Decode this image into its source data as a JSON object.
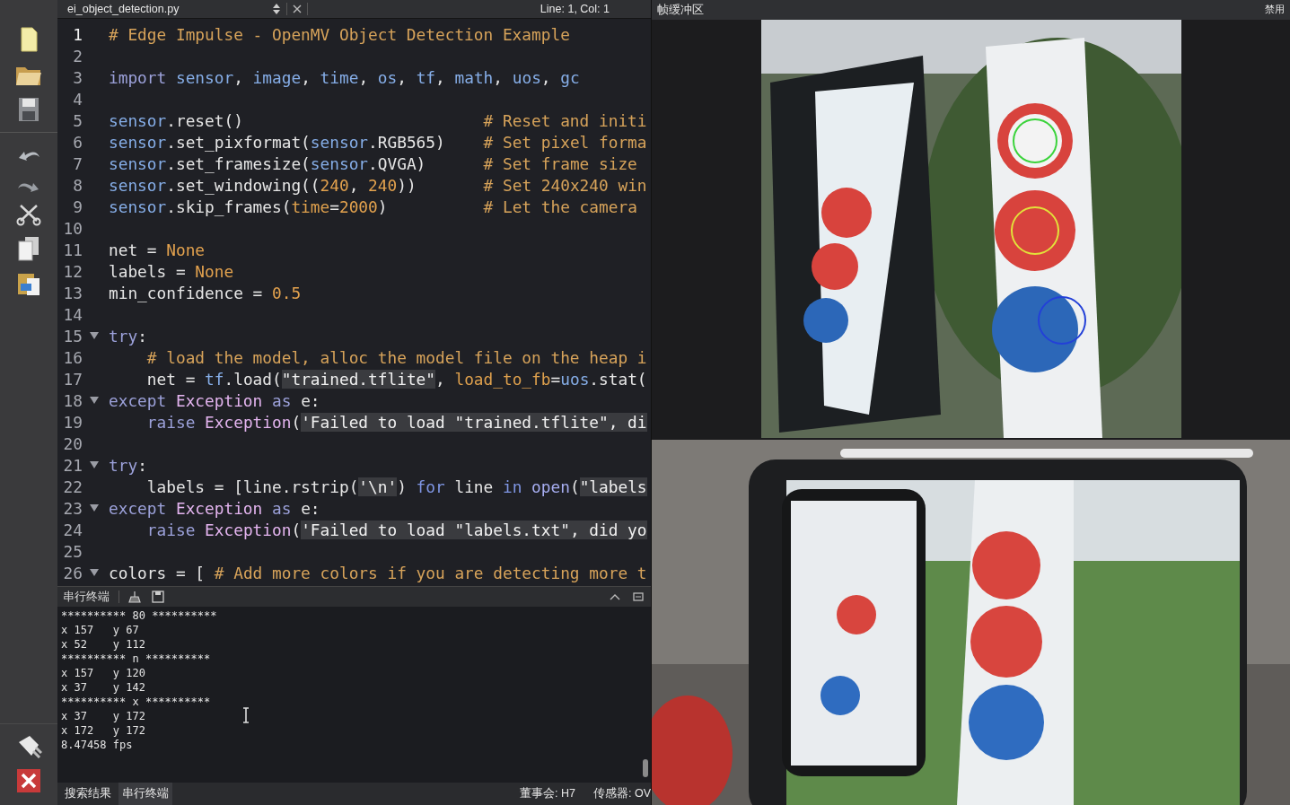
{
  "editor": {
    "file_name": "ei_object_detection.py",
    "cursor_position": "Line: 1, Col: 1",
    "lines": [
      {
        "number": "1",
        "current": true,
        "foldable": false,
        "tokens": [
          {
            "kind": "comment",
            "text": "# Edge Impulse - OpenMV Object Detection Example"
          }
        ]
      },
      {
        "number": "2",
        "current": false,
        "foldable": false
      },
      {
        "number": "3",
        "current": false,
        "foldable": false,
        "tokens": [
          {
            "kind": "keyword",
            "text": "import "
          },
          {
            "kind": "module",
            "text": "sensor"
          },
          {
            "kind": "plain",
            "text": ", "
          },
          {
            "kind": "module",
            "text": "image"
          },
          {
            "kind": "plain",
            "text": ", "
          },
          {
            "kind": "module",
            "text": "time"
          },
          {
            "kind": "plain",
            "text": ", "
          },
          {
            "kind": "module",
            "text": "os"
          },
          {
            "kind": "plain",
            "text": ", "
          },
          {
            "kind": "module",
            "text": "tf"
          },
          {
            "kind": "plain",
            "text": ", "
          },
          {
            "kind": "module",
            "text": "math"
          },
          {
            "kind": "plain",
            "text": ", "
          },
          {
            "kind": "module",
            "text": "uos"
          },
          {
            "kind": "plain",
            "text": ", "
          },
          {
            "kind": "module",
            "text": "gc"
          }
        ]
      },
      {
        "number": "4",
        "current": false,
        "foldable": false
      },
      {
        "number": "5",
        "current": false,
        "foldable": false,
        "tokens": [
          {
            "kind": "module",
            "text": "sensor"
          },
          {
            "kind": "plain",
            "text": ".reset()                         "
          },
          {
            "kind": "comment",
            "text": "# Reset and initi"
          }
        ]
      },
      {
        "number": "6",
        "current": false,
        "foldable": false,
        "tokens": [
          {
            "kind": "module",
            "text": "sensor"
          },
          {
            "kind": "plain",
            "text": ".set_pixformat("
          },
          {
            "kind": "module",
            "text": "sensor"
          },
          {
            "kind": "plain",
            "text": ".RGB565)    "
          },
          {
            "kind": "comment",
            "text": "# Set pixel forma"
          }
        ]
      },
      {
        "number": "7",
        "current": false,
        "foldable": false,
        "tokens": [
          {
            "kind": "module",
            "text": "sensor"
          },
          {
            "kind": "plain",
            "text": ".set_framesize("
          },
          {
            "kind": "module",
            "text": "sensor"
          },
          {
            "kind": "plain",
            "text": ".QVGA)      "
          },
          {
            "kind": "comment",
            "text": "# Set frame size"
          }
        ]
      },
      {
        "number": "8",
        "current": false,
        "foldable": false,
        "tokens": [
          {
            "kind": "module",
            "text": "sensor"
          },
          {
            "kind": "plain",
            "text": ".set_windowing(("
          },
          {
            "kind": "constant",
            "text": "240"
          },
          {
            "kind": "plain",
            "text": ", "
          },
          {
            "kind": "constant",
            "text": "240"
          },
          {
            "kind": "plain",
            "text": "))       "
          },
          {
            "kind": "comment",
            "text": "# Set 240x240 win"
          }
        ]
      },
      {
        "number": "9",
        "current": false,
        "foldable": false,
        "tokens": [
          {
            "kind": "module",
            "text": "sensor"
          },
          {
            "kind": "plain",
            "text": ".skip_frames("
          },
          {
            "kind": "param",
            "text": "time"
          },
          {
            "kind": "plain",
            "text": "="
          },
          {
            "kind": "constant",
            "text": "2000"
          },
          {
            "kind": "plain",
            "text": ")          "
          },
          {
            "kind": "comment",
            "text": "# Let the camera"
          }
        ]
      },
      {
        "number": "10",
        "current": false,
        "foldable": false
      },
      {
        "number": "11",
        "current": false,
        "foldable": false,
        "tokens": [
          {
            "kind": "plain",
            "text": "net = "
          },
          {
            "kind": "constant",
            "text": "None"
          }
        ]
      },
      {
        "number": "12",
        "current": false,
        "foldable": false,
        "tokens": [
          {
            "kind": "plain",
            "text": "labels = "
          },
          {
            "kind": "constant",
            "text": "None"
          }
        ]
      },
      {
        "number": "13",
        "current": false,
        "foldable": false,
        "tokens": [
          {
            "kind": "plain",
            "text": "min_confidence = "
          },
          {
            "kind": "constant",
            "text": "0.5"
          }
        ]
      },
      {
        "number": "14",
        "current": false,
        "foldable": false
      },
      {
        "number": "15",
        "current": false,
        "foldable": true,
        "tokens": [
          {
            "kind": "keyword",
            "text": "try"
          },
          {
            "kind": "plain",
            "text": ":"
          }
        ]
      },
      {
        "number": "16",
        "current": false,
        "foldable": false,
        "tokens": [
          {
            "kind": "comment",
            "text": "    # load the model, alloc the model file on the heap i"
          }
        ]
      },
      {
        "number": "17",
        "current": false,
        "foldable": false,
        "tokens": [
          {
            "kind": "plain",
            "text": "    net = "
          },
          {
            "kind": "module",
            "text": "tf"
          },
          {
            "kind": "plain",
            "text": ".load("
          },
          {
            "kind": "string",
            "text": "\"trained.tflite\""
          },
          {
            "kind": "plain",
            "text": ", "
          },
          {
            "kind": "param",
            "text": "load_to_fb"
          },
          {
            "kind": "plain",
            "text": "="
          },
          {
            "kind": "module",
            "text": "uos"
          },
          {
            "kind": "plain",
            "text": ".stat("
          }
        ]
      },
      {
        "number": "18",
        "current": false,
        "foldable": true,
        "tokens": [
          {
            "kind": "keyword",
            "text": "except "
          },
          {
            "kind": "class",
            "text": "Exception "
          },
          {
            "kind": "keyword",
            "text": "as"
          },
          {
            "kind": "plain",
            "text": " e:"
          }
        ]
      },
      {
        "number": "19",
        "current": false,
        "foldable": false,
        "tokens": [
          {
            "kind": "keyword",
            "text": "    raise "
          },
          {
            "kind": "class",
            "text": "Exception"
          },
          {
            "kind": "plain",
            "text": "("
          },
          {
            "kind": "string",
            "text": "'Failed to load \"trained.tflite\", di"
          }
        ]
      },
      {
        "number": "20",
        "current": false,
        "foldable": false
      },
      {
        "number": "21",
        "current": false,
        "foldable": true,
        "tokens": [
          {
            "kind": "keyword",
            "text": "try"
          },
          {
            "kind": "plain",
            "text": ":"
          }
        ]
      },
      {
        "number": "22",
        "current": false,
        "foldable": false,
        "tokens": [
          {
            "kind": "plain",
            "text": "    labels = [line.rstrip("
          },
          {
            "kind": "string",
            "text": "'\\n'"
          },
          {
            "kind": "plain",
            "text": ") "
          },
          {
            "kind": "flow",
            "text": "for"
          },
          {
            "kind": "plain",
            "text": " line "
          },
          {
            "kind": "flow",
            "text": "in "
          },
          {
            "kind": "builtin",
            "text": "open"
          },
          {
            "kind": "plain",
            "text": "("
          },
          {
            "kind": "string",
            "text": "\"labels"
          }
        ]
      },
      {
        "number": "23",
        "current": false,
        "foldable": true,
        "tokens": [
          {
            "kind": "keyword",
            "text": "except "
          },
          {
            "kind": "class",
            "text": "Exception "
          },
          {
            "kind": "keyword",
            "text": "as"
          },
          {
            "kind": "plain",
            "text": " e:"
          }
        ]
      },
      {
        "number": "24",
        "current": false,
        "foldable": false,
        "tokens": [
          {
            "kind": "keyword",
            "text": "    raise "
          },
          {
            "kind": "class",
            "text": "Exception"
          },
          {
            "kind": "plain",
            "text": "("
          },
          {
            "kind": "string",
            "text": "'Failed to load \"labels.txt\", did yo"
          }
        ]
      },
      {
        "number": "25",
        "current": false,
        "foldable": false
      },
      {
        "number": "26",
        "current": false,
        "foldable": true,
        "tokens": [
          {
            "kind": "plain",
            "text": "colors = [ "
          },
          {
            "kind": "comment",
            "text": "# Add more colors if you are detecting more t"
          }
        ]
      }
    ]
  },
  "terminal": {
    "title": "串行终端",
    "lines": [
      "********** 80 **********",
      "x 157   y 67",
      "x 52    y 112",
      "********** n **********",
      "x 157   y 120",
      "x 37    y 142",
      "********** x **********",
      "x 37    y 172",
      "x 172   y 172",
      "8.47458 fps"
    ]
  },
  "bottom_tabs": [
    {
      "label": "搜索结果",
      "selected": false
    },
    {
      "label": "串行终端",
      "selected": true
    }
  ],
  "status": [
    "董事会: H7",
    "传感器: OV"
  ],
  "frame_buffer": {
    "title": "帧缓冲区",
    "disable_label": "禁用"
  }
}
